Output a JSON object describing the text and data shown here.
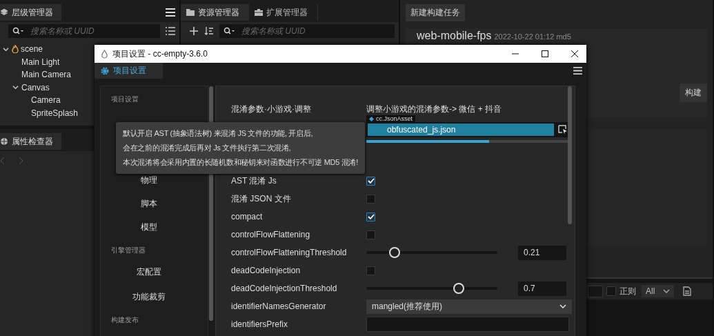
{
  "hierarchy": {
    "title": "层级管理器",
    "search": {
      "placeholder": "搜索名称或 UUID"
    },
    "tree": [
      {
        "label": "scene",
        "kind": "scene",
        "expanded": true,
        "children": [
          {
            "label": "Main Light"
          },
          {
            "label": "Main Camera"
          },
          {
            "label": "Canvas",
            "expanded": true,
            "children": [
              {
                "label": "Camera"
              },
              {
                "label": "SpriteSplash"
              }
            ]
          }
        ]
      }
    ]
  },
  "inspector": {
    "title": "属性检查器"
  },
  "assets": {
    "tabs": [
      {
        "label": "资源管理器",
        "kind": "folder",
        "selected": true
      },
      {
        "label": "扩展管理器",
        "kind": "toolbox",
        "selected": false
      }
    ],
    "search": {
      "placeholder": "搜索名称或 UUID"
    }
  },
  "build": {
    "new_task_button": "新建构建任务",
    "task": {
      "name": "web-mobile-fps",
      "meta": "2022-10-22 01:12 md5"
    },
    "build_button": "构建"
  },
  "console": {
    "regex_label": "正则",
    "regex_checked": false,
    "level_filter": "All"
  },
  "dialog": {
    "title": "项目设置 - cc-empty-3.6.0",
    "tab": "项目设置",
    "nav": [
      {
        "title": "项目设置",
        "items": [
          {
            "label": "物理"
          },
          {
            "label": "脚本"
          },
          {
            "label": "模型"
          }
        ]
      },
      {
        "title": "引擎管理器",
        "items": [
          {
            "label": "宏配置"
          },
          {
            "label": "功能裁剪"
          }
        ]
      },
      {
        "title": "构建发布"
      }
    ],
    "header": {
      "label": "混淆参数·小游戏·调整",
      "value": "调整小游戏的混淆参数-> 微信 + 抖音"
    },
    "asset": {
      "type_tag": "cc.JsonAsset",
      "value": "obfuscated_js.json",
      "level": 0.6
    },
    "rows": [
      {
        "label": "AST 混淆 Js",
        "kind": "checkbox",
        "checked": true
      },
      {
        "label": "混淆 JSON 文件",
        "kind": "checkbox",
        "checked": false
      },
      {
        "label": "compact",
        "kind": "checkbox",
        "checked": true
      },
      {
        "label": "controlFlowFlattening",
        "kind": "checkbox",
        "checked": false
      },
      {
        "label": "controlFlowFlatteningThreshold",
        "kind": "slider",
        "level": 0.21,
        "value": "0.21"
      },
      {
        "label": "deadCodeInjection",
        "kind": "checkbox",
        "checked": false
      },
      {
        "label": "deadCodeInjectionThreshold",
        "kind": "slider",
        "level": 0.7,
        "value": "0.7"
      },
      {
        "label": "identifierNamesGenerator",
        "kind": "select",
        "value": "mangled(推荐使用)"
      },
      {
        "label": "identifiersPrefix",
        "kind": "input"
      }
    ],
    "tooltip": {
      "lines": [
        "默认开启 AST (抽象语法树) 来混淆 JS 文件的功能, 开启后,",
        "会在之前的混淆完成后再对 Js 文件执行第二次混淆,",
        "本次混淆将会采用内置的长随机数和秘钥来对函数进行不可逆 MD5 混淆!"
      ]
    }
  }
}
